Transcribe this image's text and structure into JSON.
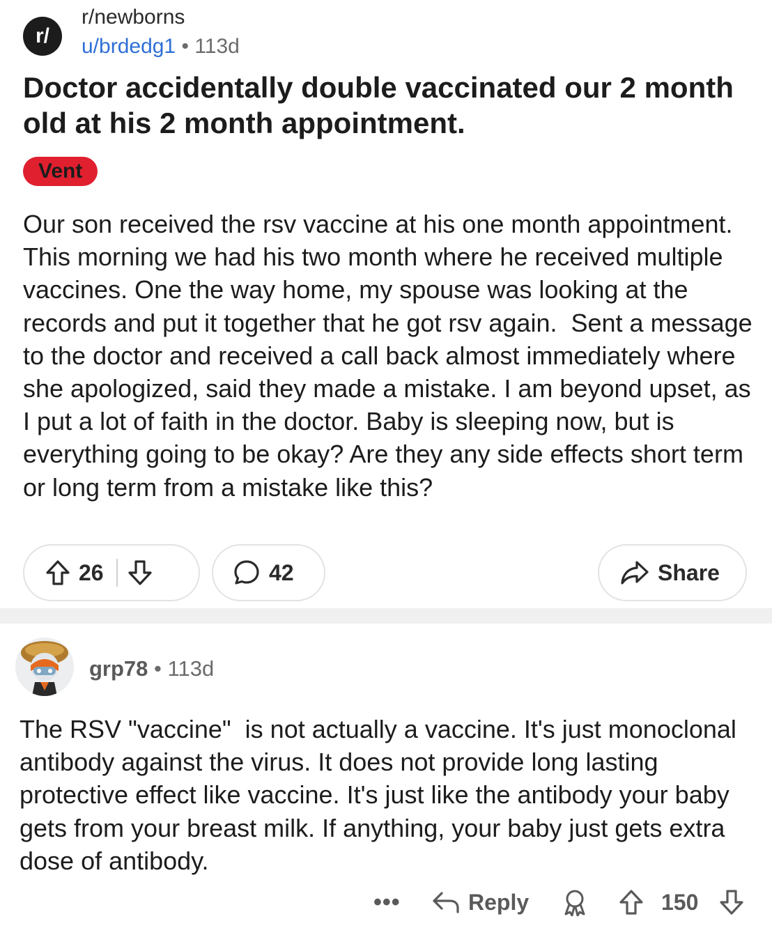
{
  "post": {
    "subreddit_icon_text": "r/",
    "subreddit": "r/newborns",
    "author": "u/brdedg1",
    "separator": "•",
    "age": "113d",
    "title": "Doctor accidentally double vaccinated our 2 month old at his 2 month appointment.",
    "flair": "Vent",
    "flair_color": "#e0202f",
    "body": "Our son received the rsv vaccine at his one month appointment. This morning we had his two month where he received multiple vaccines. One the way home, my spouse was looking at the records and put it together that he got rsv again.  Sent a message to the doctor and received a call back almost immediately where she apologized, said they made a mistake. I am beyond upset, as I put a lot of faith in the doctor. Baby is sleeping now, but is everything going to be okay? Are they any side effects short term or long term from a mistake like this?",
    "score": "26",
    "comments": "42",
    "share_label": "Share",
    "icons": [
      "upvote-icon",
      "downvote-icon",
      "comment-icon",
      "share-icon"
    ]
  },
  "comment": {
    "author": "grp78",
    "separator": "•",
    "age": "113d",
    "text": "The RSV \"vaccine\"  is not actually a vaccine. It's just monoclonal antibody against the virus. It does not provide long lasting protective effect like vaccine. It's just like the antibody your baby gets from your breast milk. If anything, your baby just gets extra dose of antibody.",
    "more_label": "•••",
    "reply_label": "Reply",
    "score": "150",
    "icons": [
      "more-icon",
      "reply-icon",
      "award-icon",
      "upvote-icon",
      "downvote-icon"
    ]
  }
}
